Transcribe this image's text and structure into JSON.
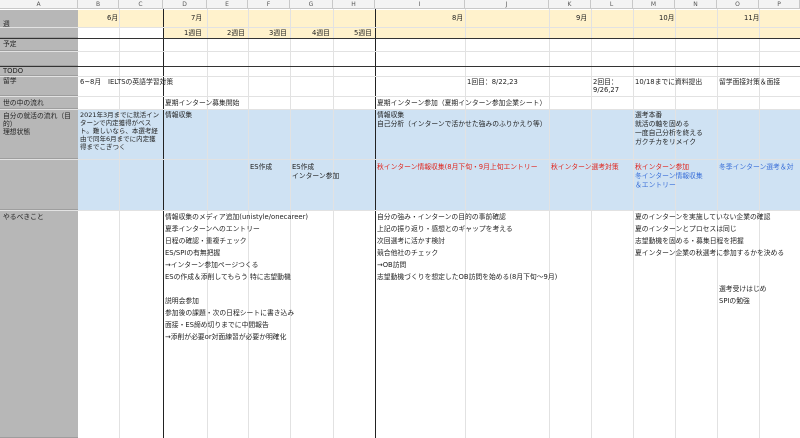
{
  "columns": [
    "A",
    "B",
    "C",
    "D",
    "E",
    "F",
    "G",
    "H",
    "I",
    "J",
    "K",
    "L",
    "M",
    "N",
    "O",
    "P"
  ],
  "rows": {
    "week_label": "週",
    "plan_label": "予定",
    "todo_label": "TODO",
    "study_abroad_label": "留学",
    "world_flow_label": "世の中の流れ",
    "own_flow_label": "自分の就活の流れ（目的）\n理想状態",
    "todo_items_label": "やるべきこと"
  },
  "months": {
    "june": "6月",
    "july": "7月",
    "august": "8月",
    "september": "9月",
    "october": "10月",
    "november": "11月"
  },
  "weeks": [
    "1週目",
    "2週目",
    "3週目",
    "4週目",
    "5週目"
  ],
  "study_abroad": {
    "ielts": "6~8月　IELTSの英語学習対策",
    "first": "1回目：8/22,23",
    "second": "2回目：\n9/26,27",
    "submit": "10/18までに資料提出",
    "interview": "留学面接対策＆面接"
  },
  "world_flow": {
    "july": "夏期インターン募集開始",
    "august": "夏期インターン参加（夏期インターン参加企業シート）"
  },
  "own_flow": {
    "goal": "2021年3月までに就活インターンで内定獲得がベスト。難しいなら、本選考経由で同年6月までに内定獲得までこぎつく",
    "july": "情報収集",
    "august_1": "情報収集",
    "august_2": "自己分析（インターンで活かせた強みのふりかえり等）",
    "oct_1": "選考本番",
    "oct_2": "就活の軸を固める",
    "oct_3": "一度自己分析を終える",
    "oct_4": "ガクチカをリメイク"
  },
  "events": {
    "es_1": "ES作成",
    "es_2": "ES作成",
    "intern_join": "インターン参加",
    "autumn_info": "秋インターン情報収集(8月下旬・9月上旬エントリー",
    "autumn_select": "秋インターン選考対策",
    "autumn_join": "秋インターン参加",
    "winter_info": "冬インターン情報収集",
    "winter_entry": "＆エントリー",
    "winter_select": "冬季インターン選考＆対"
  },
  "todo": {
    "july": [
      "情報収集のメディア追加(unistyle/onecareer)",
      "夏季インターンへのエントリー",
      "日程の確認・重複チェック",
      "ES/SPIの有無把握",
      "→インターン参加ページつくる",
      "ESの作成＆添削してもらう 特に志望動機"
    ],
    "july_b": [
      "説明会参加",
      "参加後の課題・次の日程シートに書き込み",
      "面接・ES締め切りまでに中間報告",
      "→添削が必要or対面練習が必要か明確化"
    ],
    "august": [
      "自分の強み・インターンの目的の事前確認",
      "上記の振り返り・感想とのギャップを考える",
      "次回選考に活かす検討",
      "競合他社のチェック",
      "→OB訪問",
      "志望動機づくりを想定したOB訪問を始める(8月下旬～9月)"
    ],
    "october": [
      "夏のインターンを実施していない企業の確認",
      "夏のインターンとプロセスは同じ",
      "志望動機を固める・募集日程を把握",
      "夏インターン企業の秋選考に参加するかを決める"
    ],
    "november": [
      "選考受けはじめ",
      "SPIの勉強"
    ]
  },
  "colors": {
    "row_header": "#b7b7b7",
    "month_row": "#fff2cc",
    "blue_band": "#cfe2f3",
    "red_text": "#e0251d",
    "blue_text": "#3a6fd8"
  }
}
